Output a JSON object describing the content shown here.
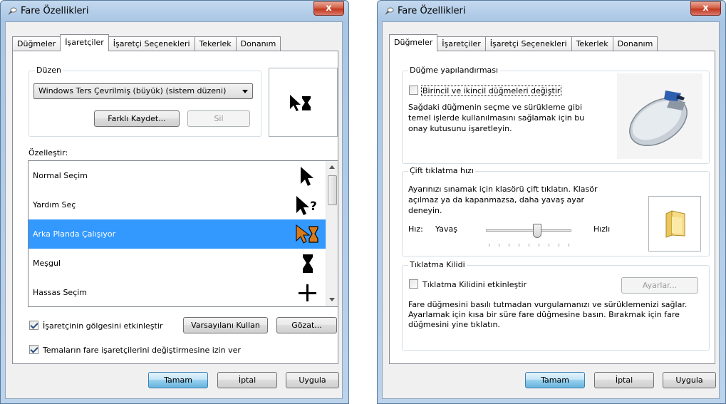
{
  "left_window": {
    "title": "Fare Özellikleri",
    "close_label": "x",
    "tabs": [
      "Düğmeler",
      "İşaretçiler",
      "İşaretçi Seçenekleri",
      "Tekerlek",
      "Donanım"
    ],
    "active_tab": "İşaretçiler",
    "scheme_legend": "Düzen",
    "scheme_value": "Windows Ters Çevrilmiş (büyük) (sistem düzeni)",
    "save_as_label": "Farklı Kaydet...",
    "delete_label": "Sil",
    "customize_label": "Özelleştir:",
    "cursors": [
      {
        "name": "Normal Seçim",
        "icon": "arrow-cursor-icon"
      },
      {
        "name": "Yardım Seç",
        "icon": "help-cursor-icon"
      },
      {
        "name": "Arka Planda Çalışıyor",
        "icon": "background-busy-cursor-icon"
      },
      {
        "name": "Meşgul",
        "icon": "busy-cursor-icon"
      },
      {
        "name": "Hassas Seçim",
        "icon": "crosshair-cursor-icon"
      }
    ],
    "selected_cursor": "Arka Planda Çalışıyor",
    "shadow_label": "İşaretçinin gölgesini etkinleştir",
    "shadow_checked": true,
    "use_default_label": "Varsayılanı Kullan",
    "browse_label": "Gözat...",
    "themes_label": "Temaların fare işaretçilerini değiştirmesine izin ver",
    "themes_checked": true,
    "ok_label": "Tamam",
    "cancel_label": "İptal",
    "apply_label": "Uygula"
  },
  "right_window": {
    "title": "Fare Özellikleri",
    "close_label": "x",
    "tabs": [
      "Düğmeler",
      "İşaretçiler",
      "İşaretçi Seçenekleri",
      "Tekerlek",
      "Donanım"
    ],
    "active_tab": "Düğmeler",
    "button_config_legend": "Düğme yapılandırması",
    "switch_buttons_label": "Birincil ve ikincil düğmeleri değiştir",
    "switch_buttons_checked": false,
    "switch_buttons_desc": "Sağdaki düğmenin seçme ve sürükleme gibi temel işlerde kullanılmasını sağlamak için bu onay kutusunu işaretleyin.",
    "double_click_legend": "Çift tıklatma hızı",
    "double_click_desc": "Ayarınızı sınamak için klasörü çift tıklatın. Klasör açılmaz ya da kapanmazsa, daha yavaş ayar deneyin.",
    "speed_label": "Hız:",
    "slow_label": "Yavaş",
    "fast_label": "Hızlı",
    "click_lock_legend": "Tıklatma Kilidi",
    "click_lock_label": "Tıklatma Kilidini etkinleştir",
    "click_lock_checked": false,
    "settings_label": "Ayarlar...",
    "click_lock_desc": "Fare düğmesini basılı tutmadan vurgulamanızı ve sürüklemenizi sağlar. Ayarlamak için kısa bir süre fare düğmesine basın. Bırakmak için fare düğmesini yine tıklatın.",
    "ok_label": "Tamam",
    "cancel_label": "İptal",
    "apply_label": "Uygula"
  }
}
